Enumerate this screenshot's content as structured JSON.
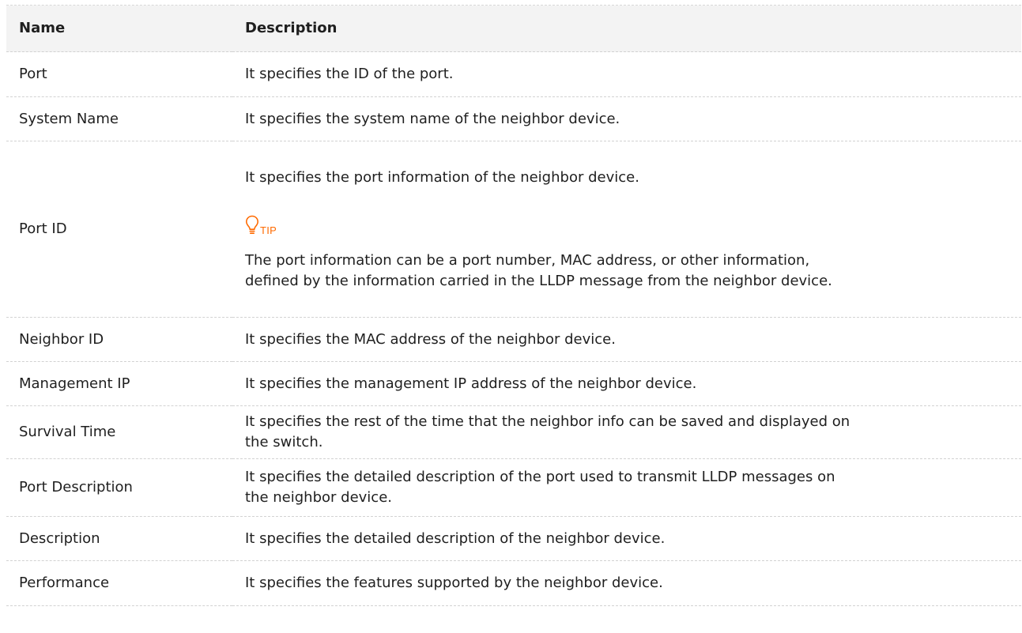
{
  "table": {
    "headers": [
      "Name",
      "Description"
    ],
    "rows": [
      {
        "name": "Port",
        "description": "It specifies the ID of the port."
      },
      {
        "name": "System Name",
        "description": "It specifies the system name of the neighbor device."
      },
      {
        "name": "Port ID",
        "description": "It specifies the port information of the neighbor device.",
        "tip": {
          "icon": "lightbulb-icon",
          "label": "TIP",
          "text_line_1": "The port information can be a port number, MAC address, or other information,",
          "text_line_2": "defined by the information carried in the LLDP message from the neighbor device."
        }
      },
      {
        "name": "Neighbor ID",
        "description": "It specifies the MAC address of the neighbor device."
      },
      {
        "name": "Management IP",
        "description": "It specifies the management IP address of the neighbor device."
      },
      {
        "name": "Survival Time",
        "description_line_1": "It specifies the rest of the time that the neighbor info can be saved and displayed on",
        "description_line_2": "the switch."
      },
      {
        "name": "Port Description",
        "description_line_1": "It specifies the detailed description of the port used to transmit LLDP messages on",
        "description_line_2": "the neighbor device."
      },
      {
        "name": "Description",
        "description": "It specifies the detailed description of the neighbor device."
      },
      {
        "name": "Performance",
        "description": "It specifies the features supported by the neighbor device."
      }
    ]
  },
  "colors": {
    "header_background": "#f3f3f3",
    "tip_accent": "#ff6a00",
    "row_divider": "#d2d2d2",
    "text": "#1f1f1f"
  }
}
